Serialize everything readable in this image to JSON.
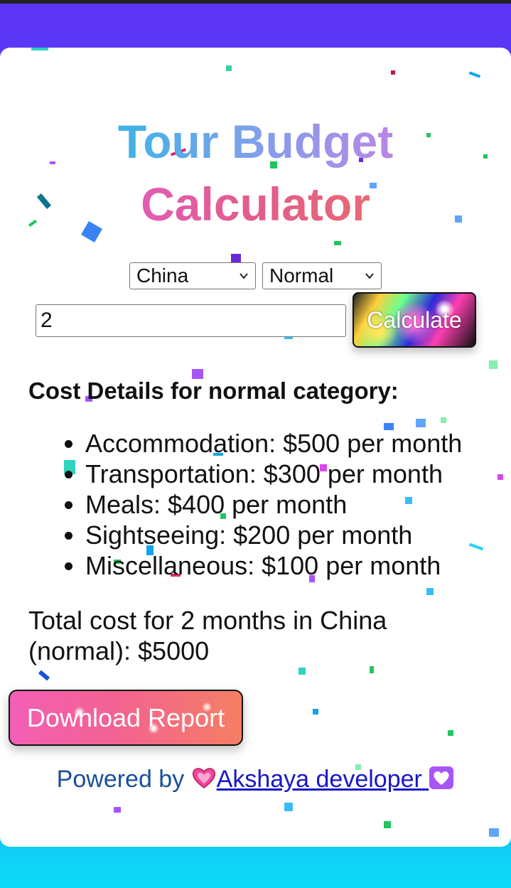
{
  "title": {
    "line1": "Tour Budget",
    "line2": "Calculator"
  },
  "form": {
    "country_selected": "China",
    "category_selected": "Normal",
    "months_value": "2",
    "calculate_label": "Calculate"
  },
  "cost": {
    "heading": "Cost Details for normal category:",
    "items": [
      "Accommodation: $500 per month",
      "Transportation: $300 per month",
      "Meals: $400 per month",
      "Sightseeing: $200 per month",
      "Miscellaneous: $100 per month"
    ],
    "total_text": "Total cost for 2 months in China (normal): $5000"
  },
  "download_label": "Download Report",
  "footer": {
    "powered_prefix": "Powered by",
    "link_text": "Akshaya developer",
    "heart_left_icon": "pink-heart-icon",
    "heart_right_icon": "white-heart-icon"
  },
  "colors": {
    "header_purple": "#5c34f6",
    "bottom_cyan": "#0adcf7",
    "link_blue": "#1717c8",
    "powered_text": "#1a4f9a"
  }
}
